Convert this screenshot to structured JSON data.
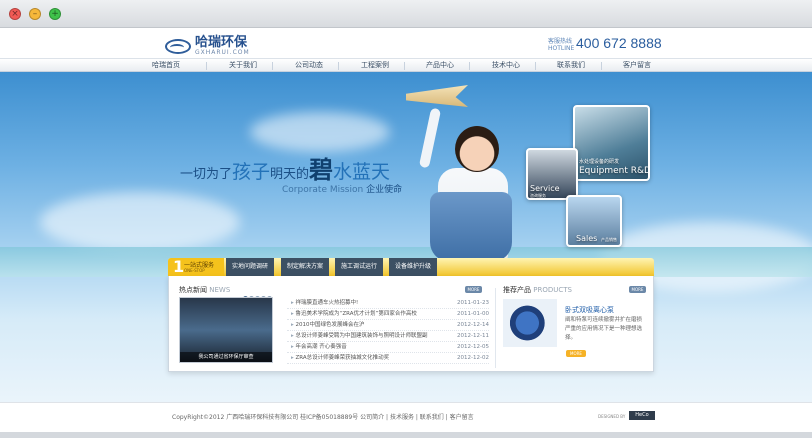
{
  "window": {
    "close": "×",
    "minimize": "–",
    "maximize": "+"
  },
  "header": {
    "logo_cn": "哈瑞环保",
    "logo_en": "GXHARUI.COM",
    "hotline_cn": "客服热线",
    "hotline_en": "HOTLINE",
    "phone": "400 672 8888"
  },
  "nav": [
    "哈瑞首页",
    "关于我们",
    "公司动态",
    "工程案例",
    "产品中心",
    "技术中心",
    "联系我们",
    "客户留言"
  ],
  "banner": {
    "slogan_a": "一切为了",
    "slogan_b": "孩子",
    "slogan_c": "明天的",
    "slogan_d": "碧",
    "slogan_e": "水蓝天",
    "mission_en": "Corporate Mission",
    "mission_cn": "企业使命",
    "tile_equipment_cn": "水处理设备的研发",
    "tile_equipment_en": "Equipment R&D",
    "tile_service_en": "Service",
    "tile_service_cn": "咨询服务",
    "tile_sales_en": "Sales",
    "tile_sales_cn": "产品销售"
  },
  "steps": {
    "first_num": "1",
    "first_title": "一站式服务",
    "first_sub": "ONE-STOP",
    "items": [
      "实地问题调研",
      "制定解决方案",
      "施工调试运行",
      "设备维护升级"
    ]
  },
  "news": {
    "title": "热点新闻",
    "title_en": "NEWS",
    "more": "MORE",
    "image_caption": "我公司通过省环保厅审查",
    "items": [
      {
        "title": "祥瑞膜直通车火热招募中!",
        "date": "2011-01-23"
      },
      {
        "title": "鲁迅美术学院成为“ZRA优才计划”第四家合作高校",
        "date": "2011-01-00"
      },
      {
        "title": "2010中国绿色发展峰会在沪",
        "date": "2012-12-14"
      },
      {
        "title": "总设计师姜峰受聘为中国建筑装饰与照明设计师联盟副",
        "date": "2012-12-11"
      },
      {
        "title": "年会高潮 齐心奏强音",
        "date": "2012-12-05"
      },
      {
        "title": "ZRA总设计师姜峰荣获抽城文化推动奖",
        "date": "2012-12-02"
      }
    ]
  },
  "products": {
    "title": "推荐产品",
    "title_en": "PRODUCTS",
    "more": "MORE",
    "name": "卧式双吸离心泵",
    "desc": "阐和特泵可连续撤雾并扩在磨损严重的应用情况下是一种理想选择。",
    "button": "MORE"
  },
  "footer": {
    "copyright": "CopyRight©2012  广西哈瑞环保科技有限公司  桂ICP备05018889号   公司简介  |  技术服务  |  联系我们  |  客户留言",
    "powered": "DESIGNED BY",
    "badge": "HeCo"
  }
}
